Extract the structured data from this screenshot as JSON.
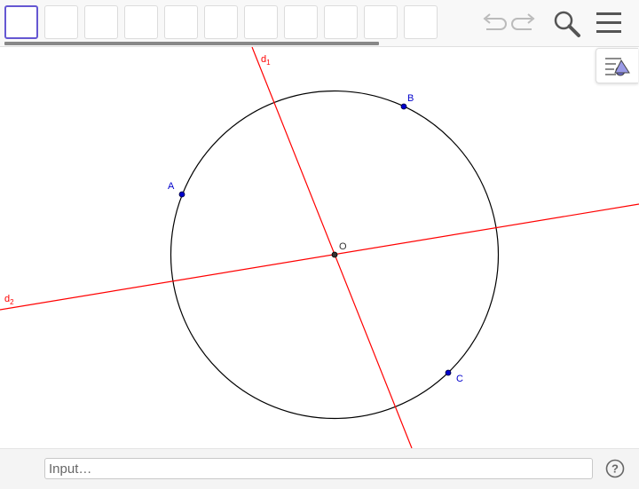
{
  "toolbar": {
    "tool_count": 11,
    "selected_tool_index": 0,
    "undo_icon": "undo-icon",
    "redo_icon": "redo-icon",
    "search_icon": "search-icon",
    "menu_icon": "hamburger-menu-icon"
  },
  "style_bar": {
    "icon": "style-bar-toggle-icon"
  },
  "graphics": {
    "colors": {
      "circle": "#000000",
      "lines": "#ff0000",
      "point": "#0000cc",
      "center": "#333333"
    },
    "points": {
      "A": "A",
      "B": "B",
      "C": "C",
      "O": "O"
    },
    "lines": {
      "d1": {
        "base": "d",
        "sub": "1"
      },
      "d2": {
        "base": "d",
        "sub": "2"
      }
    }
  },
  "footer": {
    "input_placeholder": "Input…",
    "help_icon": "help-icon",
    "help_glyph": "?"
  }
}
